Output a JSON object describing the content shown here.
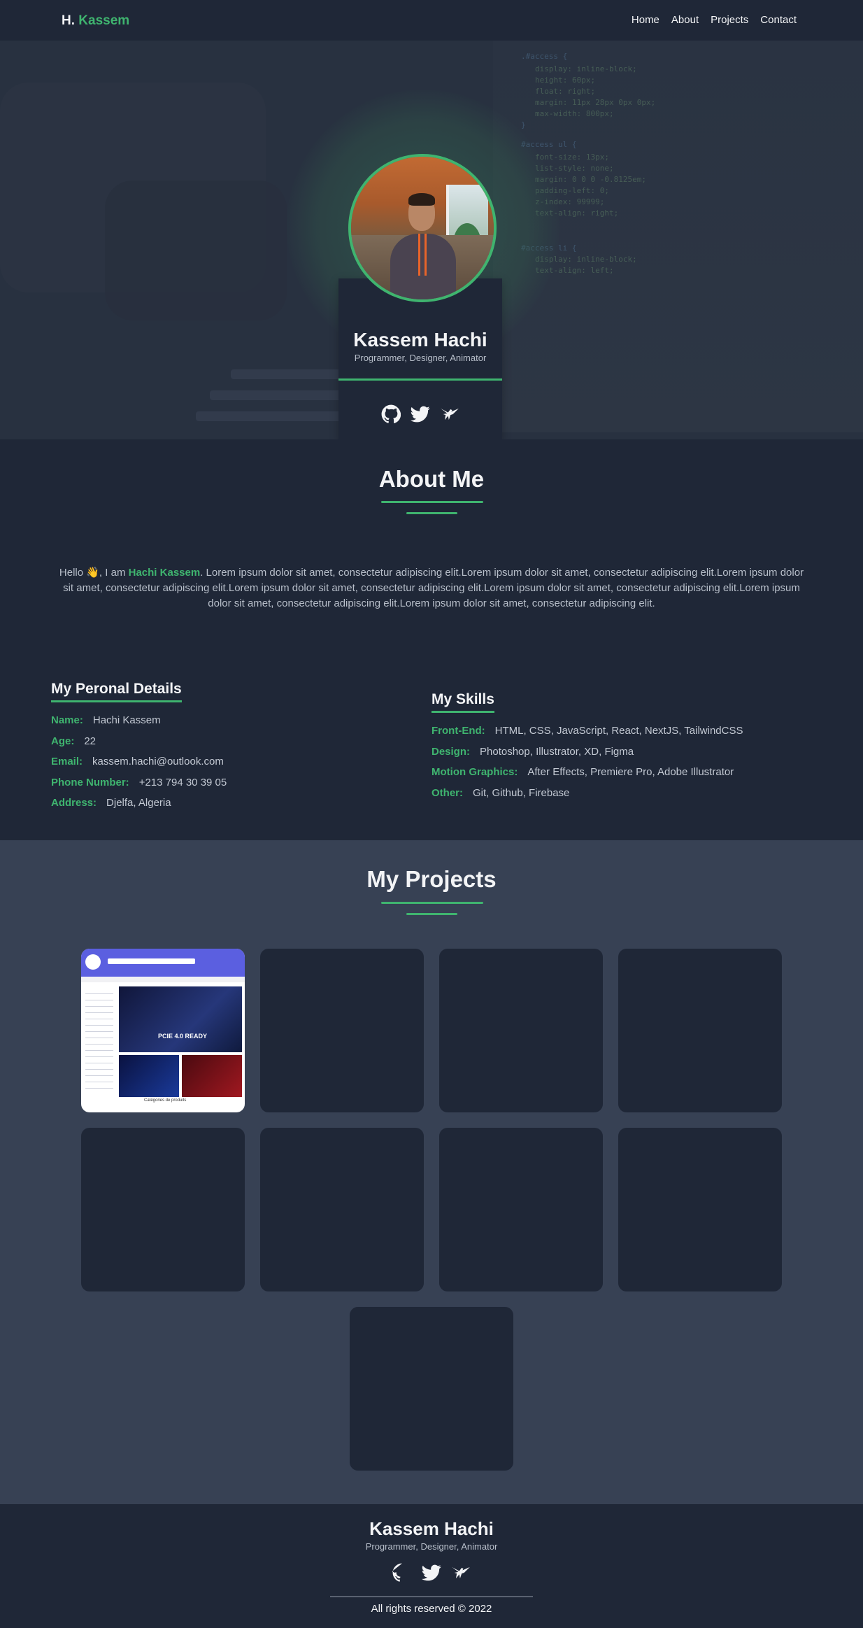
{
  "nav": {
    "brand_prefix": "H.",
    "brand_name": "Kassem",
    "links": [
      "Home",
      "About",
      "Projects",
      "Contact"
    ]
  },
  "hero": {
    "name": "Kassem Hachi",
    "role": "Programmer, Designer, Animator",
    "socials": [
      "github-icon",
      "twitter-icon",
      "hummingbird-icon"
    ]
  },
  "about": {
    "title": "About Me",
    "greeting": "Hello 👋, I am",
    "name": "Hachi Kassem",
    "text": ". Lorem ipsum dolor sit amet, consectetur adipiscing elit.Lorem ipsum dolor sit amet, consectetur adipiscing elit.Lorem ipsum dolor sit amet, consectetur adipiscing elit.Lorem ipsum dolor sit amet, consectetur adipiscing elit.Lorem ipsum dolor sit amet, consectetur adipiscing elit.Lorem ipsum dolor sit amet, consectetur adipiscing elit.Lorem ipsum dolor sit amet, consectetur adipiscing elit."
  },
  "details": {
    "title": "My Peronal Details",
    "rows": [
      {
        "k": "Name:",
        "v": "Hachi Kassem"
      },
      {
        "k": "Age:",
        "v": "22"
      },
      {
        "k": "Email:",
        "v": "kassem.hachi@outlook.com"
      },
      {
        "k": "Phone Number:",
        "v": "+213 794 30 39 05"
      },
      {
        "k": "Address:",
        "v": "Djelfa, Algeria"
      }
    ]
  },
  "skills": {
    "title": "My Skills",
    "rows": [
      {
        "k": "Front-End:",
        "v": "HTML, CSS, JavaScript, React, NextJS, TailwindCSS"
      },
      {
        "k": "Design:",
        "v": "Photoshop, Illustrator, XD, Figma"
      },
      {
        "k": "Motion Graphics:",
        "v": "After Effects, Premiere Pro, Adobe Illustrator"
      },
      {
        "k": "Other:",
        "v": "Git, Github, Firebase"
      }
    ]
  },
  "projects": {
    "title": "My Projects",
    "tile_count": 9,
    "first_tile": {
      "banner_text": "PCIE 4.0 READY",
      "footer_text": "Catégories de produits"
    }
  },
  "footer": {
    "name": "Kassem Hachi",
    "role": "Programmer, Designer, Animator",
    "copyright": "All rights reserved © 2022"
  },
  "colors": {
    "accent": "#3fb46f",
    "background": "#1f2737",
    "projects_bg": "#374154"
  }
}
